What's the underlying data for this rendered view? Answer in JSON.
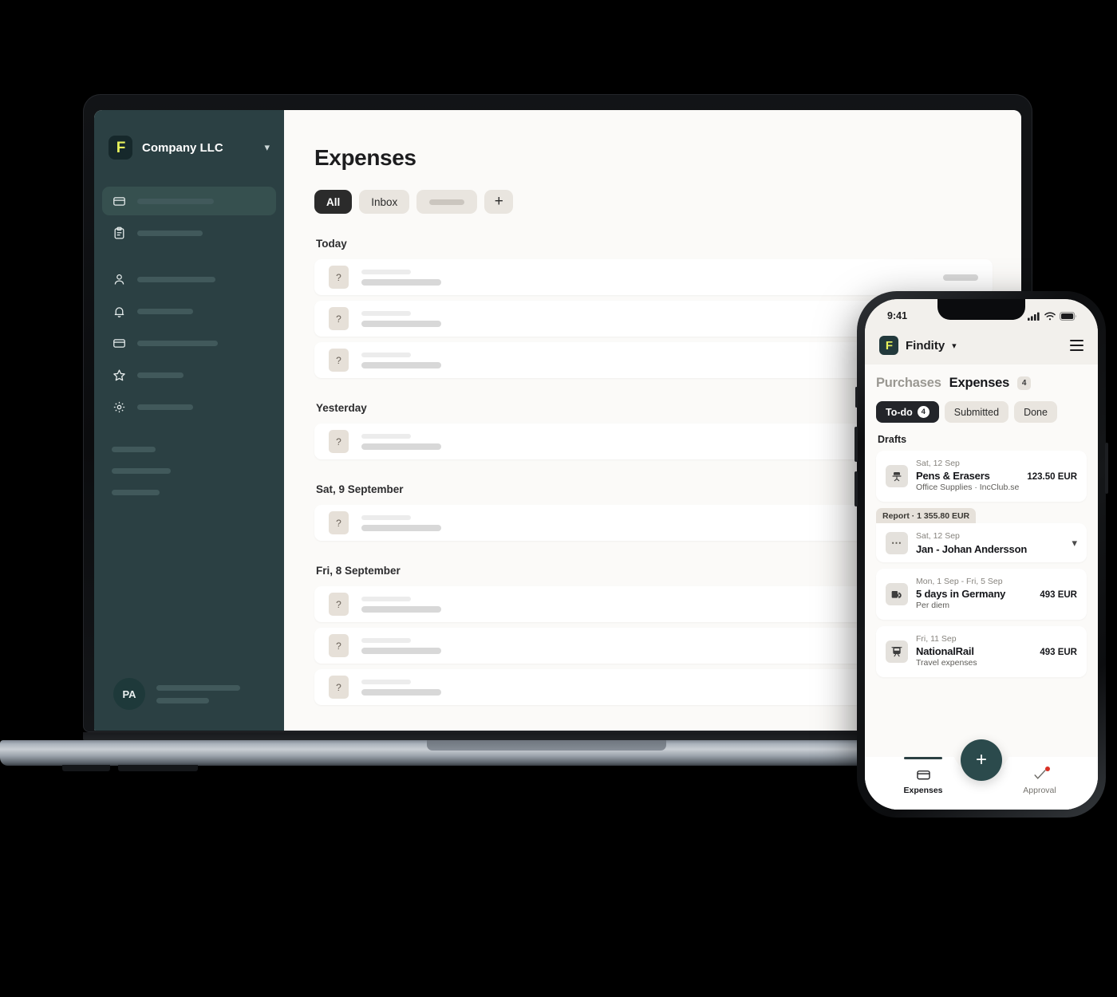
{
  "desktop": {
    "sidebar": {
      "brand": "Company LLC",
      "brand_chevron": "chevron-down",
      "logo_glyph": "F",
      "items": [
        {
          "icon": "card-icon",
          "active": true,
          "skeleton_width": 96
        },
        {
          "icon": "clipboard-icon",
          "active": false,
          "skeleton_width": 82
        },
        {
          "icon": "person-icon",
          "active": false,
          "skeleton_width": 98
        },
        {
          "icon": "bell-icon",
          "active": false,
          "skeleton_width": 70
        },
        {
          "icon": "card-icon",
          "active": false,
          "skeleton_width": 101
        },
        {
          "icon": "star-icon",
          "active": false,
          "skeleton_width": 58
        },
        {
          "icon": "gear-icon",
          "active": false,
          "skeleton_width": 70
        }
      ],
      "footer_skeletons": [
        55,
        74,
        60
      ],
      "user": {
        "initials": "PA",
        "line1_width": 105,
        "line2_width": 66
      }
    },
    "main": {
      "title": "Expenses",
      "tabs": [
        {
          "label": "All",
          "active": true,
          "type": "text"
        },
        {
          "label": "Inbox",
          "active": false,
          "type": "text"
        },
        {
          "label": "",
          "active": false,
          "type": "skeleton"
        },
        {
          "label": "+",
          "active": false,
          "type": "plus"
        }
      ],
      "groups": [
        {
          "date": "Today",
          "rows": 3
        },
        {
          "date": "Yesterday",
          "rows": 1
        },
        {
          "date": "Sat, 9 September",
          "rows": 1
        },
        {
          "date": "Fri, 8 September",
          "rows": 3
        }
      ],
      "row_placeholder_icon": "?"
    }
  },
  "phone": {
    "statusbar": {
      "time": "9:41",
      "icons": [
        "signal-icon",
        "wifi-icon",
        "battery-icon"
      ]
    },
    "header": {
      "brand": "Findity",
      "logo_glyph": "F",
      "chevron": "chevron-down",
      "menu": "hamburger-icon"
    },
    "main_tabs": [
      {
        "label": "Purchases",
        "active": false,
        "badge": null
      },
      {
        "label": "Expenses",
        "active": true,
        "badge": "4"
      }
    ],
    "filters": [
      {
        "label": "To-do",
        "count": "4",
        "active": true
      },
      {
        "label": "Submitted",
        "count": null,
        "active": false
      },
      {
        "label": "Done",
        "count": null,
        "active": false
      }
    ],
    "section_title": "Drafts",
    "items": [
      {
        "kind": "expense",
        "icon": "office-chair-icon",
        "date": "Sat, 12 Sep",
        "name": "Pens & Erasers",
        "amount": "123.50 EUR",
        "subtitle": "Office Supplies · IncClub.se"
      },
      {
        "kind": "report",
        "report_tag": "Report · 1 355.80 EUR",
        "icon": "more-dots-icon",
        "date": "Sat, 12 Sep",
        "name": "Jan - Johan Andersson",
        "amount": null,
        "subtitle": null,
        "expand": "chevron-down"
      },
      {
        "kind": "expense",
        "icon": "per-diem-icon",
        "date": "Mon, 1 Sep - Fri, 5 Sep",
        "name": "5 days in Germany",
        "amount": "493 EUR",
        "subtitle": "Per diem"
      },
      {
        "kind": "expense",
        "icon": "train-icon",
        "date": "Fri, 11 Sep",
        "name": "NationalRail",
        "amount": "493 EUR",
        "subtitle": "Travel expenses"
      }
    ],
    "tabbar": {
      "items": [
        {
          "label": "Expenses",
          "icon": "card-icon",
          "active": true,
          "badge": false
        },
        {
          "label": "Approval",
          "icon": "check-icon",
          "active": false,
          "badge": true
        }
      ],
      "fab": "+"
    }
  },
  "colors": {
    "sidebar_bg": "#2b4043",
    "sidebar_active": "#36504f",
    "accent_yellow": "#e7f25c",
    "app_bg": "#fbfaf8",
    "chip_bg": "#e9e5df",
    "chip_active": "#2b2b2b",
    "fab": "#2b4a4c",
    "badge_red": "#d93025"
  }
}
